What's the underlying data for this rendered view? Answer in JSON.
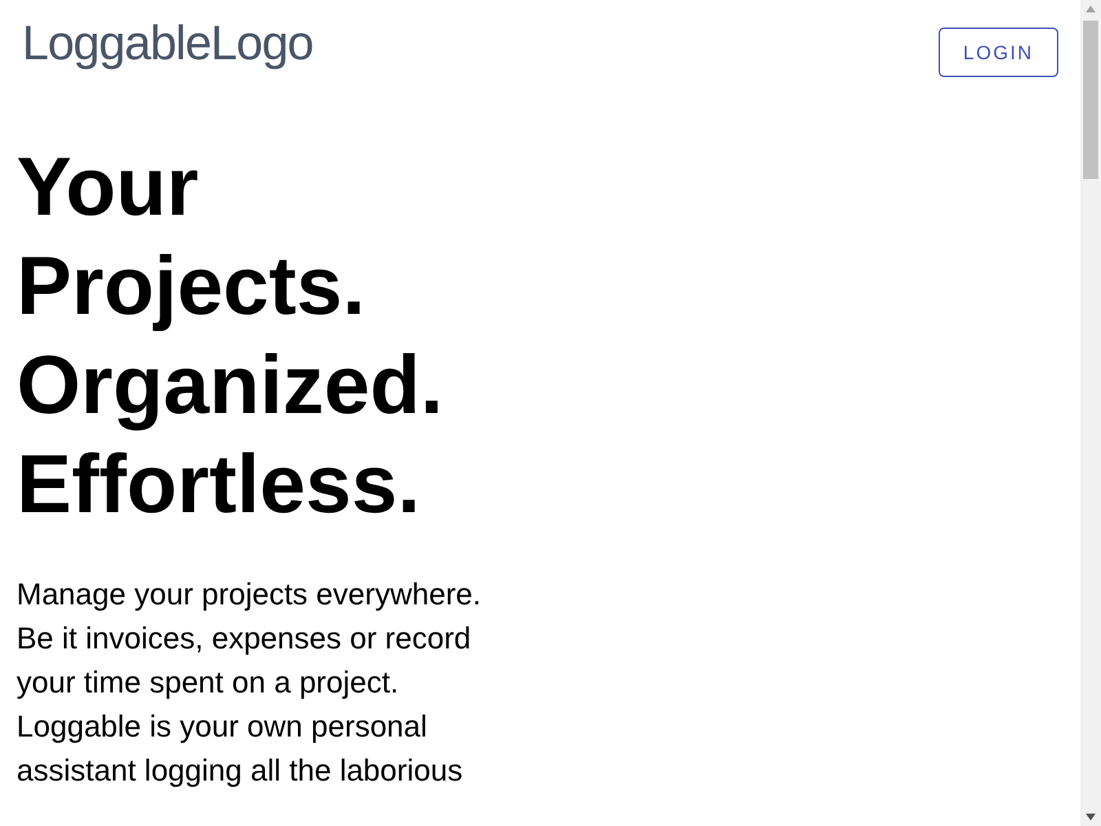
{
  "header": {
    "logo": "LoggableLogo",
    "login_button": "LOGIN"
  },
  "hero": {
    "headline": "Your Projects. Organized. Effortless.",
    "description": "Manage your projects everywhere. Be it invoices, expenses or record your time spent on a project. Loggable is your own personal assistant logging all the laborious"
  }
}
